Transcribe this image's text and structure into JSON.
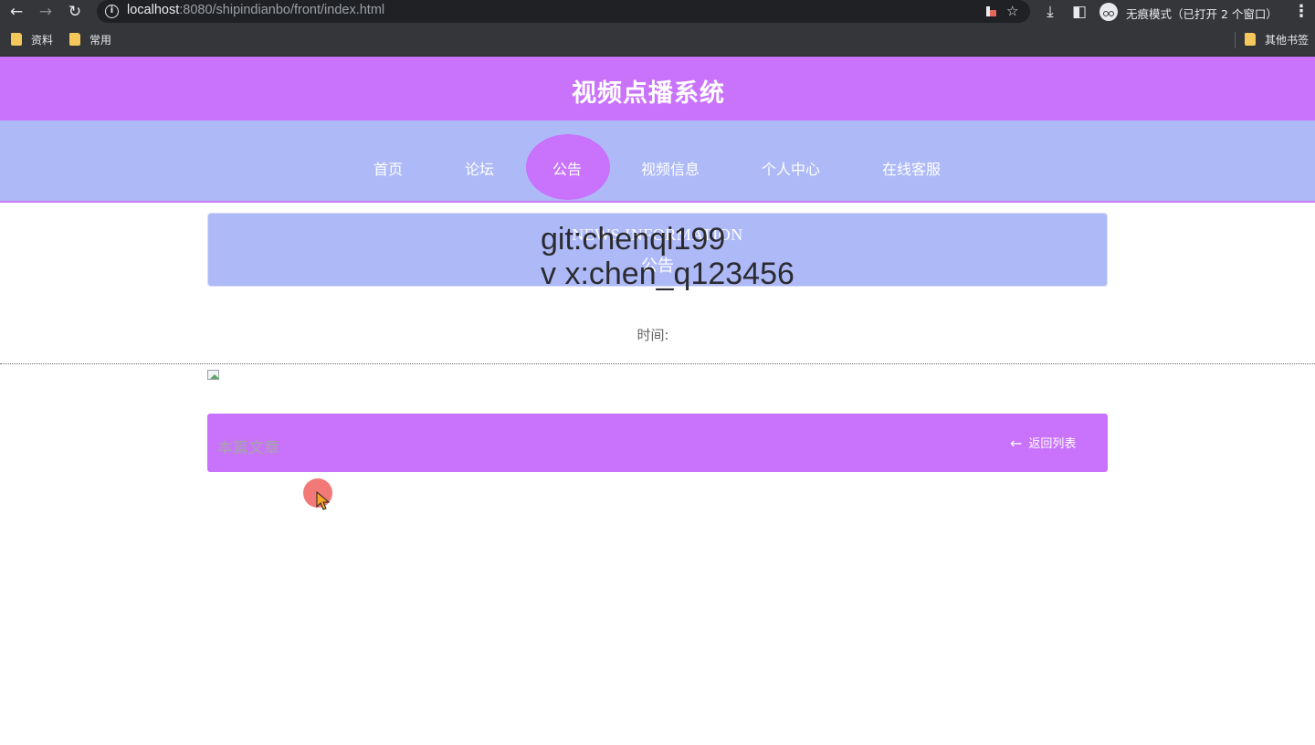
{
  "browser": {
    "url_host": "localhost",
    "url_path": ":8080/shipindianbo/front/index.html",
    "incognito_label": "无痕模式（已打开 2 个窗口）",
    "bookmarks": [
      "资料",
      "常用"
    ],
    "other_bookmarks": "其他书签"
  },
  "site": {
    "title": "视频点播系统"
  },
  "nav": {
    "items": [
      "首页",
      "论坛",
      "公告",
      "视频信息",
      "个人中心",
      "在线客服"
    ],
    "active": "公告"
  },
  "banner": {
    "en": "NEWS INFORMATION",
    "cn": "公告"
  },
  "watermark": {
    "line1": "git:chenqi199",
    "line2": "v x:chen_q123456"
  },
  "detail": {
    "time_label": "时间:",
    "action_left": "本篇文章",
    "back_label": "返回列表"
  },
  "colors": {
    "primary": "#c973fd",
    "secondary": "#aebaf8"
  }
}
